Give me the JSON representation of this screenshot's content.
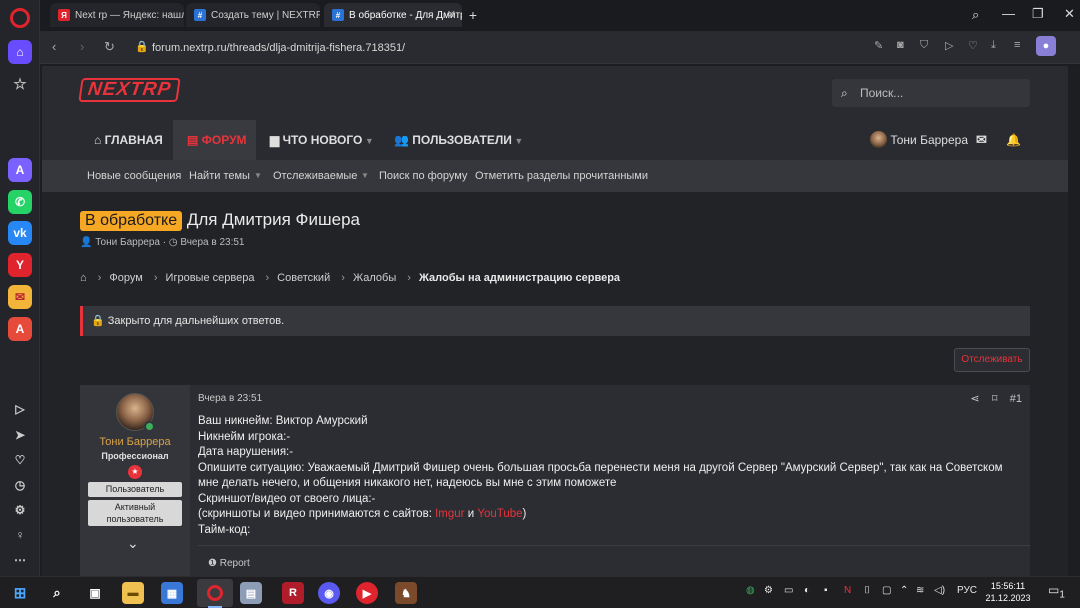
{
  "browser": {
    "tabs": [
      {
        "favicon": "yandex-icon",
        "label": "Next rp — Яндекс: нашло"
      },
      {
        "favicon": "nextrp-icon",
        "label": "Создать тему | NEXTRP"
      },
      {
        "favicon": "nextrp-icon",
        "label": "В обработке - Для Дмитр"
      }
    ],
    "url": "forum.nextrp.ru/threads/dlja-dmitrija-fishera.718351/"
  },
  "site": {
    "logo_text": "NEXTRP",
    "search_placeholder": "Поиск..."
  },
  "nav": {
    "items": [
      "ГЛАВНАЯ",
      "ФОРУМ",
      "ЧТО НОВОГО",
      "ПОЛЬЗОВАТЕЛИ"
    ],
    "user_name": "Тони Баррера"
  },
  "subnav": [
    "Новые сообщения",
    "Найти темы",
    "Отслеживаемые",
    "Поиск по форуму",
    "Отметить разделы прочитанными"
  ],
  "thread": {
    "prefix": "В обработке",
    "title": "Для Дмитрия Фишера",
    "author": "Тони Баррера",
    "date": "Вчера в 23:51",
    "closed_notice": "Закрыто для дальнейших ответов.",
    "watch_label": "Отслеживать"
  },
  "breadcrumbs": [
    "Форум",
    "Игровые сервера",
    "Советский",
    "Жалобы",
    "Жалобы на администрацию сервера"
  ],
  "post": {
    "author": "Тони Баррера",
    "author_title": "Профессионал",
    "banners": [
      "Пользователь",
      "Активный пользователь"
    ],
    "date": "Вчера в 23:51",
    "number": "#1",
    "lines": [
      "Ваш никнейм: Виктор Амурский",
      "Никнейм игрока:-",
      "Дата нарушения:-",
      "Опишите ситуацию: Уважаемый Дмитрий Фишер очень большая просьба перенести меня на другой Сервер \"Амурский Сервер\", так как на Советском мне делать нечего, и общения никакого нет, надеюсь вы мне с этим поможете",
      "Скриншот/видео от своего лица:-"
    ],
    "source_prefix": "(скриншоты и видео принимаются с сайтов: ",
    "source_link1": "Imgur",
    "source_and": " и ",
    "source_link2": "YouTube",
    "source_suffix": ")",
    "last_line": "Тайм-код:",
    "report_label": "Report"
  },
  "taskbar": {
    "lang": "РУС",
    "time": "15:56:11",
    "date": "21.12.2023",
    "notifications": "1"
  },
  "colors": {
    "accent": "#e8333b",
    "prefix": "#f6a724",
    "opera": "#e0242d"
  }
}
